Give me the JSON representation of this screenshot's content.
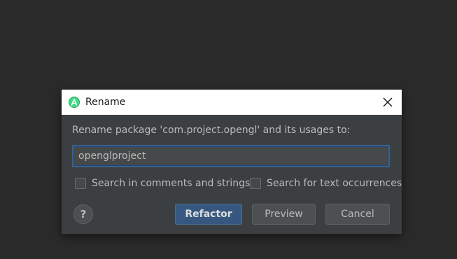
{
  "dialog": {
    "title": "Rename",
    "app_icon": "android-studio-icon",
    "close_icon": "close-icon",
    "prompt": "Rename package 'com.project.opengl' and its usages to:",
    "input_value": "openglproject",
    "options": [
      {
        "label": "Search in comments and strings",
        "checked": false
      },
      {
        "label": "Search for text occurrences",
        "checked": false
      }
    ],
    "help_label": "?",
    "buttons": {
      "refactor": "Refactor",
      "preview": "Preview",
      "cancel": "Cancel"
    }
  },
  "colors": {
    "background": "#2b2b2b",
    "dialog_body": "#3c3f41",
    "titlebar": "#ffffff",
    "primary_button": "#365880",
    "input_focus": "#3d6185"
  }
}
